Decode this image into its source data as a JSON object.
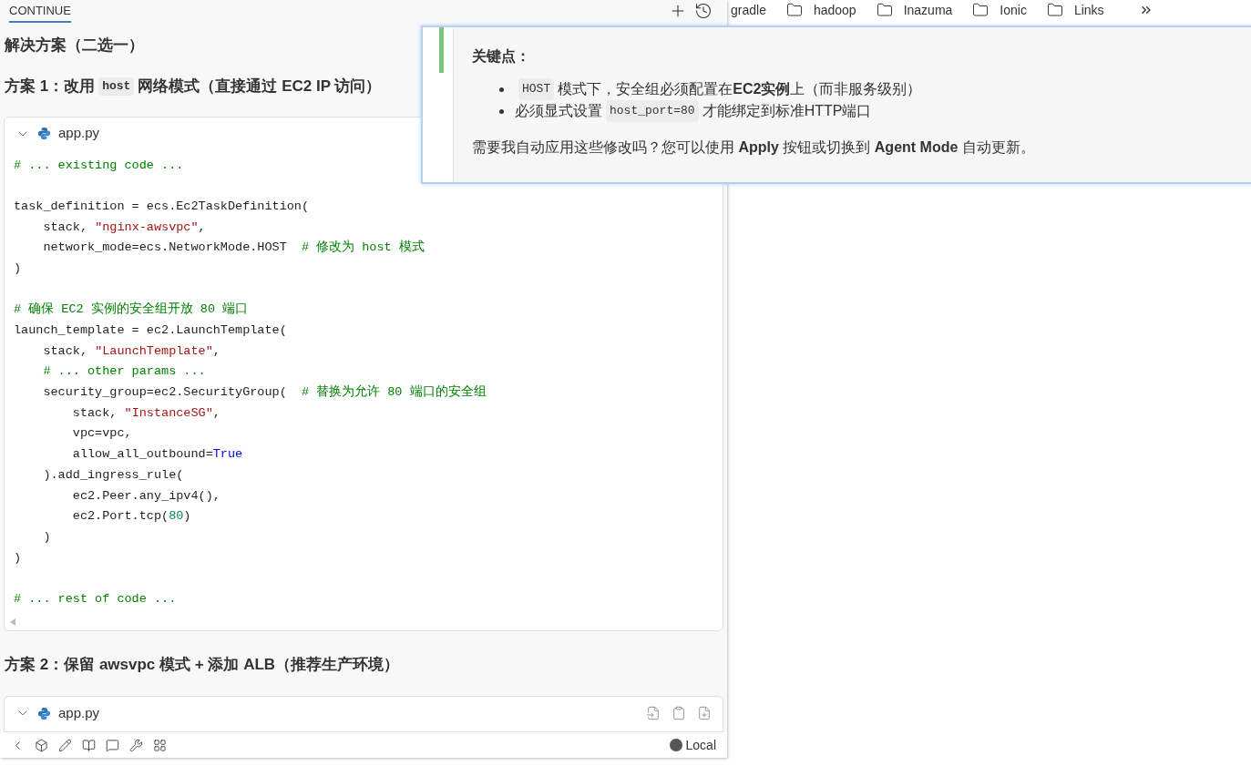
{
  "panel": {
    "tab": {
      "label": "CONTINUE",
      "selected": true
    },
    "heading": "解决方案（二选一）",
    "option_1": {
      "title_before": "方案 1：改用",
      "title_code": "host",
      "title_after": "网络模式（直接通过 EC2 IP 访问）"
    },
    "code_block_1": {
      "filename": "app.py",
      "expanded": true,
      "lines": [
        {
          "kind": "code",
          "segments": [
            {
              "kind": "comment",
              "text": "# ... existing code ..."
            }
          ]
        },
        {
          "kind": "blank"
        },
        {
          "kind": "code",
          "segments": [
            {
              "kind": "plain",
              "text": "task_definition = ecs.Ec2TaskDefinition("
            }
          ]
        },
        {
          "kind": "code",
          "segments": [
            {
              "kind": "plain",
              "text": "    stack, "
            },
            {
              "kind": "string",
              "text": "\"nginx-awsvpc\""
            },
            {
              "kind": "plain",
              "text": ","
            }
          ]
        },
        {
          "kind": "code",
          "segments": [
            {
              "kind": "plain",
              "text": "    network_mode=ecs.NetworkMode.HOST  "
            },
            {
              "kind": "comment",
              "text": "# 修改为 host 模式"
            }
          ]
        },
        {
          "kind": "code",
          "segments": [
            {
              "kind": "plain",
              "text": ")"
            }
          ]
        },
        {
          "kind": "blank"
        },
        {
          "kind": "code",
          "segments": [
            {
              "kind": "comment",
              "text": "# 确保 EC2 实例的安全组开放 80 端口"
            }
          ]
        },
        {
          "kind": "code",
          "segments": [
            {
              "kind": "plain",
              "text": "launch_template = ec2.LaunchTemplate("
            }
          ]
        },
        {
          "kind": "code",
          "segments": [
            {
              "kind": "plain",
              "text": "    stack, "
            },
            {
              "kind": "string",
              "text": "\"LaunchTemplate\""
            },
            {
              "kind": "plain",
              "text": ","
            }
          ]
        },
        {
          "kind": "code",
          "segments": [
            {
              "kind": "comment",
              "text": "    # ... other params ..."
            }
          ]
        },
        {
          "kind": "code",
          "segments": [
            {
              "kind": "plain",
              "text": "    security_group=ec2.SecurityGroup(  "
            },
            {
              "kind": "comment",
              "text": "# 替换为允许 80 端口的安全组"
            }
          ]
        },
        {
          "kind": "code",
          "segments": [
            {
              "kind": "plain",
              "text": "        stack, "
            },
            {
              "kind": "string",
              "text": "\"InstanceSG\""
            },
            {
              "kind": "plain",
              "text": ","
            }
          ]
        },
        {
          "kind": "code",
          "segments": [
            {
              "kind": "plain",
              "text": "        vpc=vpc,"
            }
          ]
        },
        {
          "kind": "code",
          "segments": [
            {
              "kind": "plain",
              "text": "        allow_all_outbound="
            },
            {
              "kind": "keyword",
              "text": "True"
            }
          ]
        },
        {
          "kind": "code",
          "segments": [
            {
              "kind": "plain",
              "text": "    ).add_ingress_rule("
            }
          ]
        },
        {
          "kind": "code",
          "segments": [
            {
              "kind": "plain",
              "text": "        ec2.Peer.any_ipv4(),"
            }
          ]
        },
        {
          "kind": "code",
          "segments": [
            {
              "kind": "plain",
              "text": "        ec2.Port.tcp("
            },
            {
              "kind": "number",
              "text": "80"
            },
            {
              "kind": "plain",
              "text": ")"
            }
          ]
        },
        {
          "kind": "code",
          "segments": [
            {
              "kind": "plain",
              "text": "    )"
            }
          ]
        },
        {
          "kind": "code",
          "segments": [
            {
              "kind": "plain",
              "text": ")"
            }
          ]
        },
        {
          "kind": "blank"
        },
        {
          "kind": "code",
          "segments": [
            {
              "kind": "comment",
              "text": "# ... rest of code ..."
            }
          ]
        }
      ]
    },
    "option_2": {
      "title": "方案 2：保留 awsvpc 模式 + 添加 ALB（推荐生产环境）"
    },
    "code_block_2": {
      "filename": "app.py",
      "expanded": true
    },
    "status": {
      "model": "Local"
    }
  },
  "bookmarks": [
    "gradle",
    "hadoop",
    "Inazuma",
    "Ionic",
    "Links"
  ],
  "popup": {
    "title": "关键点：",
    "bullets": [
      {
        "code": "HOST",
        "text": "模式下，安全组必须配置在**EC2实例**上（而非服务级别）"
      },
      {
        "before": "必须显式设置",
        "code": "host_port=80",
        "text": "才能绑定到标准HTTP端口"
      }
    ],
    "question": "需要我自动应用这些修改吗？您可以使用 **Apply** 按钮或切换到 **Agent Mode** 自动更新。"
  }
}
